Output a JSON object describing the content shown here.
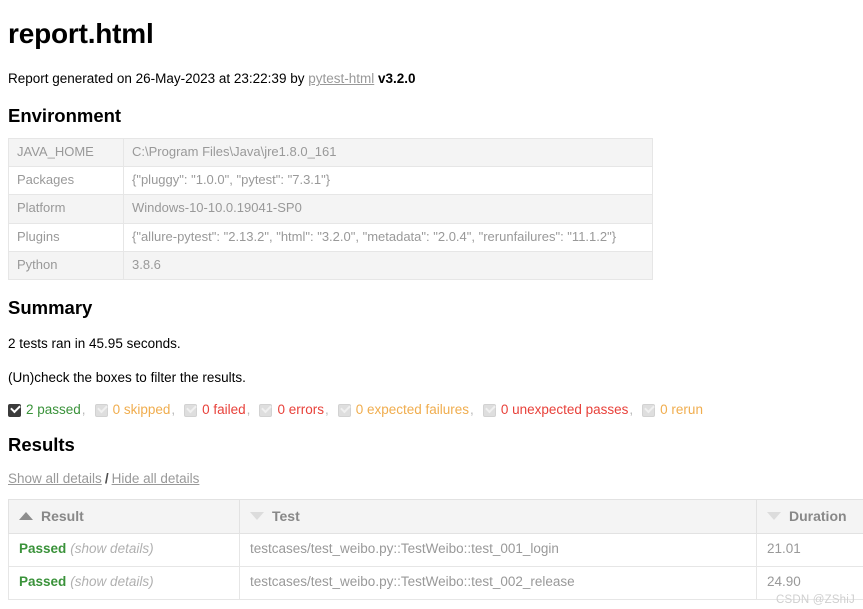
{
  "page": {
    "title": "report.html",
    "generated_prefix": "Report generated on ",
    "generated_datetime": "26-May-2023 at 23:22:39",
    "generated_by": " by ",
    "generator_link": "pytest-html",
    "generator_version": "v3.2.0"
  },
  "environment": {
    "heading": "Environment",
    "rows": [
      {
        "key": "JAVA_HOME",
        "value": "C:\\Program Files\\Java\\jre1.8.0_161"
      },
      {
        "key": "Packages",
        "value": "{\"pluggy\": \"1.0.0\", \"pytest\": \"7.3.1\"}"
      },
      {
        "key": "Platform",
        "value": "Windows-10-10.0.19041-SP0"
      },
      {
        "key": "Plugins",
        "value": "{\"allure-pytest\": \"2.13.2\", \"html\": \"3.2.0\", \"metadata\": \"2.0.4\", \"rerunfailures\": \"11.1.2\"}"
      },
      {
        "key": "Python",
        "value": "3.8.6"
      }
    ]
  },
  "summary": {
    "heading": "Summary",
    "run_line": "2 tests ran in 45.95 seconds.",
    "filter_hint": "(Un)check the boxes to filter the results.",
    "filters": [
      {
        "label": "2 passed",
        "checked": true,
        "color": "#3a923a",
        "comma": true
      },
      {
        "label": "0 skipped",
        "checked": false,
        "color": "#f0ad4e",
        "comma": true
      },
      {
        "label": "0 failed",
        "checked": false,
        "color": "#e8413a",
        "comma": true
      },
      {
        "label": "0 errors",
        "checked": false,
        "color": "#e8413a",
        "comma": true
      },
      {
        "label": "0 expected failures",
        "checked": false,
        "color": "#f0ad4e",
        "comma": true
      },
      {
        "label": "0 unexpected passes",
        "checked": false,
        "color": "#e8413a",
        "comma": true
      },
      {
        "label": "0 rerun",
        "checked": false,
        "color": "#f0ad4e",
        "comma": false
      }
    ]
  },
  "results": {
    "heading": "Results",
    "show_all": "Show all details",
    "slash": "/",
    "hide_all": "Hide all details",
    "columns": [
      {
        "label": "Result",
        "sort": "asc"
      },
      {
        "label": "Test",
        "sort": "desc"
      },
      {
        "label": "Duration",
        "sort": "desc"
      }
    ],
    "rows": [
      {
        "result": "Passed",
        "details_label": "(show details)",
        "test": "testcases/test_weibo.py::TestWeibo::test_001_login",
        "duration": "21.01"
      },
      {
        "result": "Passed",
        "details_label": "(show details)",
        "test": "testcases/test_weibo.py::TestWeibo::test_002_release",
        "duration": "24.90"
      }
    ]
  },
  "watermark": "CSDN @ZShiJ"
}
